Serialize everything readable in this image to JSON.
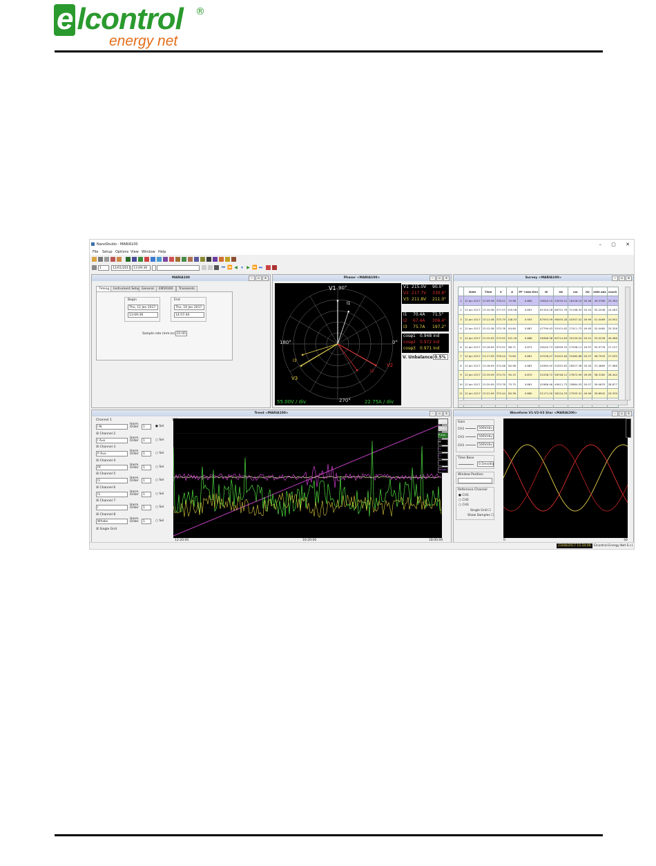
{
  "logo": {
    "line1_prefix": "e",
    "line1_rest": "lcontrol",
    "reg": "®",
    "line2": "energy net"
  },
  "app": {
    "title": "NanoStudio - MARIA100",
    "window_controls": [
      "–",
      "▢",
      "✕"
    ],
    "menu": [
      "File",
      "Setup",
      "Options",
      "View",
      "Window",
      "Help"
    ],
    "nav": {
      "page": "1",
      "date": "12/01/2017",
      "time": "13:09:36"
    },
    "panes": {
      "maria": {
        "title": "MARIA100",
        "tabs": [
          "Timing",
          "Instrument Setup",
          "General",
          "EN50160",
          "Transients"
        ],
        "begin_label": "Begin",
        "begin_date": "Thu, 12 Jan 2017",
        "begin_time": "13:09:36",
        "end_label": "End",
        "end_date": "Thu, 19 Jan 2017",
        "end_time": "14:57:44",
        "sample_rate_label": "Sample rate (mm:ss)",
        "sample_rate": "01:00"
      },
      "phasor": {
        "title": "Phasor <MARIA100>",
        "angle_top": "90°",
        "angle_left": "180°",
        "angle_right": "0°",
        "angle_bottom": "270°",
        "labels": {
          "v1": "V1",
          "i1": "I1",
          "v2": "V2",
          "i2": "I2",
          "v3": "V3",
          "i3": "I3"
        },
        "volt_div": "55.00V / div",
        "amp_div": "22.75A / div",
        "voltages": [
          {
            "name": "V1",
            "mag": "215.0V",
            "ang": "90.0°",
            "color": "#f5f5f5"
          },
          {
            "name": "V2",
            "mag": "217.7V",
            "ang": "330.8°",
            "color": "#e03030"
          },
          {
            "name": "V3",
            "mag": "211.8V",
            "ang": "211.0°",
            "color": "#e8d24a"
          }
        ],
        "currents": [
          {
            "name": "I1",
            "mag": "70.4A",
            "ang": "71.5°",
            "color": "#f5f5f5"
          },
          {
            "name": "I2",
            "mag": "67.4A",
            "ang": "306.4°",
            "color": "#e03030"
          },
          {
            "name": "I3",
            "mag": "75.7A",
            "ang": "197.2°",
            "color": "#e8d24a"
          }
        ],
        "cosphi": [
          {
            "name": "cosφ1",
            "val": "0.948 ind",
            "color": "#f5f5f5"
          },
          {
            "name": "cosφ2",
            "val": "0.972 ind",
            "color": "#e03030"
          },
          {
            "name": "cosφ3",
            "val": "0.971 ind",
            "color": "#e8d24a"
          }
        ],
        "unbalance_label": "V. Unbalance",
        "unbalance_value": "0.5%"
      },
      "survey": {
        "title": "Survey <MARIA100>",
        "headers": [
          "",
          "Date",
          "Time",
          "V",
          "A",
          "PF +Abs-Gen",
          "W",
          "VA",
          "var",
          "Hz",
          "kWh abs",
          "kvarh"
        ],
        "rows": [
          [
            "1",
            "12 Jan 2017",
            "13:09:36",
            "376.21",
            "75.98",
            "0.865",
            "49040.15",
            "53035.51",
            "18128.19",
            "50.06",
            "49.3760",
            "23.784"
          ],
          [
            "2",
            "12 Jan 2017",
            "13:10:38",
            "377.53",
            "105.08",
            "0.891",
            "61340.28",
            "68751.76",
            "31198.43",
            "50.04",
            "50.2546",
            "24.283"
          ],
          [
            "3",
            "12 Jan 2017",
            "13:11:38",
            "375.79",
            "148.33",
            "0.903",
            "87593.59",
            "96493.28",
            "40357.02",
            "49.99",
            "51.0469",
            "24.932"
          ],
          [
            "4",
            "12 Jan 2017",
            "13:12:38",
            "375.78",
            "84.60",
            "0.867",
            "47799.43",
            "55101.62",
            "27411.73",
            "49.95",
            "52.0460",
            "25.326"
          ],
          [
            "5",
            "12 Jan 2017",
            "13:15:09",
            "374.93",
            "101.18",
            "0.888",
            "58386.38",
            "65714.63",
            "30159.04",
            "50.01",
            "53.0228",
            "26.486"
          ],
          [
            "6",
            "12 Jan 2017",
            "13:16:09",
            "373.52",
            "86.71",
            "0.873",
            "49240.73",
            "56399.52",
            "27508.11",
            "49.97",
            "55.9776",
            "27.157"
          ],
          [
            "7",
            "12 Jan 2017",
            "13:17:09",
            "376.24",
            "75.80",
            "0.861",
            "43136.47",
            "50102.64",
            "25485.66",
            "50.07",
            "56.7943",
            "27.535"
          ],
          [
            "8",
            "12 Jan 2017",
            "13:18:09",
            "374.08",
            "80.98",
            "0.863",
            "45365.92",
            "52552.62",
            "26527.36",
            "50.00",
            "57.4660",
            "27.986"
          ],
          [
            "9",
            "12 Jan 2017",
            "13:19:09",
            "374.70",
            "90.15",
            "0.870",
            "51038.72",
            "58746.12",
            "27872.99",
            "49.99",
            "58.3162",
            "28.444"
          ],
          [
            "10",
            "12 Jan 2017",
            "13:20:09",
            "375.78",
            "75.75",
            "0.861",
            "42986.46",
            "49911.73",
            "25864.03",
            "50.07",
            "59.0633",
            "28.877"
          ],
          [
            "11",
            "12 Jan 2017",
            "13:21:09",
            "375.44",
            "80.38",
            "0.880",
            "51171.00",
            "58124.33",
            "27555.31",
            "49.99",
            "59.8942",
            "29.339"
          ],
          [
            "12",
            "12 Jan 2017",
            "13:22:09",
            "373.67",
            "79.88",
            "0.862",
            "44670.03",
            "51791.27",
            "26182.09",
            "50.05",
            "60.6996",
            "29.793"
          ]
        ]
      },
      "trend": {
        "title": "Trend <MARIA100>",
        "channels": [
          {
            "label": "Channel 1",
            "value": "I:N",
            "order": "1",
            "selected": true
          },
          {
            "label": "Channel 2",
            "value": "I Aux",
            "order": "1",
            "selected": false
          },
          {
            "label": "Channel 3",
            "value": "P Aux",
            "order": "1",
            "selected": false
          },
          {
            "label": "Channel 4",
            "value": "PF",
            "order": "1",
            "selected": false
          },
          {
            "label": "Channel 5",
            "value": "I1",
            "order": "1",
            "selected": false
          },
          {
            "label": "Channel 6",
            "value": "I1",
            "order": "1",
            "selected": false
          },
          {
            "label": "Channel 7",
            "value": "I",
            "order": "1",
            "selected": false
          },
          {
            "label": "Channel 8",
            "value": "Whabs",
            "order": "1",
            "selected": false
          }
        ],
        "harm_label": "Harm. Order",
        "sel_label": "Sel",
        "single_grid": "Single Grid",
        "ymax": "100",
        "x_ticks": [
          "12:20:00",
          "16:20:00",
          "18:00:00"
        ],
        "legend": [
          "I:N",
          "I Aux",
          "P Aux",
          "PF",
          "I1",
          "I1",
          "I",
          "Whabs"
        ]
      },
      "waveform": {
        "title": "Waveform V1-V2-V3 Star <MARIA100>",
        "gain_label": "Gain",
        "gains": [
          {
            "ch": "CH1",
            "val": "500V/div"
          },
          {
            "ch": "CH1",
            "val": "500V/div"
          },
          {
            "ch": "CH1",
            "val": "500V/div"
          }
        ],
        "timebase_label": "Time Base",
        "timebase_val": "0.5ms/div",
        "window_pos_label": "Window Position",
        "ref_label": "Reference Channel",
        "ref_channels": [
          "CH1",
          "CH2",
          "CH3"
        ],
        "single_grid": "Single Grid",
        "show_samples": "Show Samples",
        "x_start": "0",
        "x_end": "30"
      }
    },
    "status": {
      "datetime": "23/08/2017 15:34:48",
      "company": "Elcontrol Energy Net S.r.l."
    }
  }
}
